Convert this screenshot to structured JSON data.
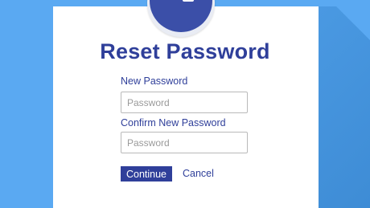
{
  "form": {
    "title": "Reset Password",
    "new_password_label": "New Password",
    "new_password_placeholder": "Password",
    "confirm_password_label": "Confirm New Password",
    "confirm_password_placeholder": "Password",
    "continue_label": "Continue",
    "cancel_label": "Cancel"
  },
  "colors": {
    "background": "#5aa9f2",
    "accent": "#2f3f9a",
    "avatar": "#3b4fa8",
    "card": "#ffffff"
  },
  "icons": {
    "avatar": "lock-avatar-icon"
  }
}
